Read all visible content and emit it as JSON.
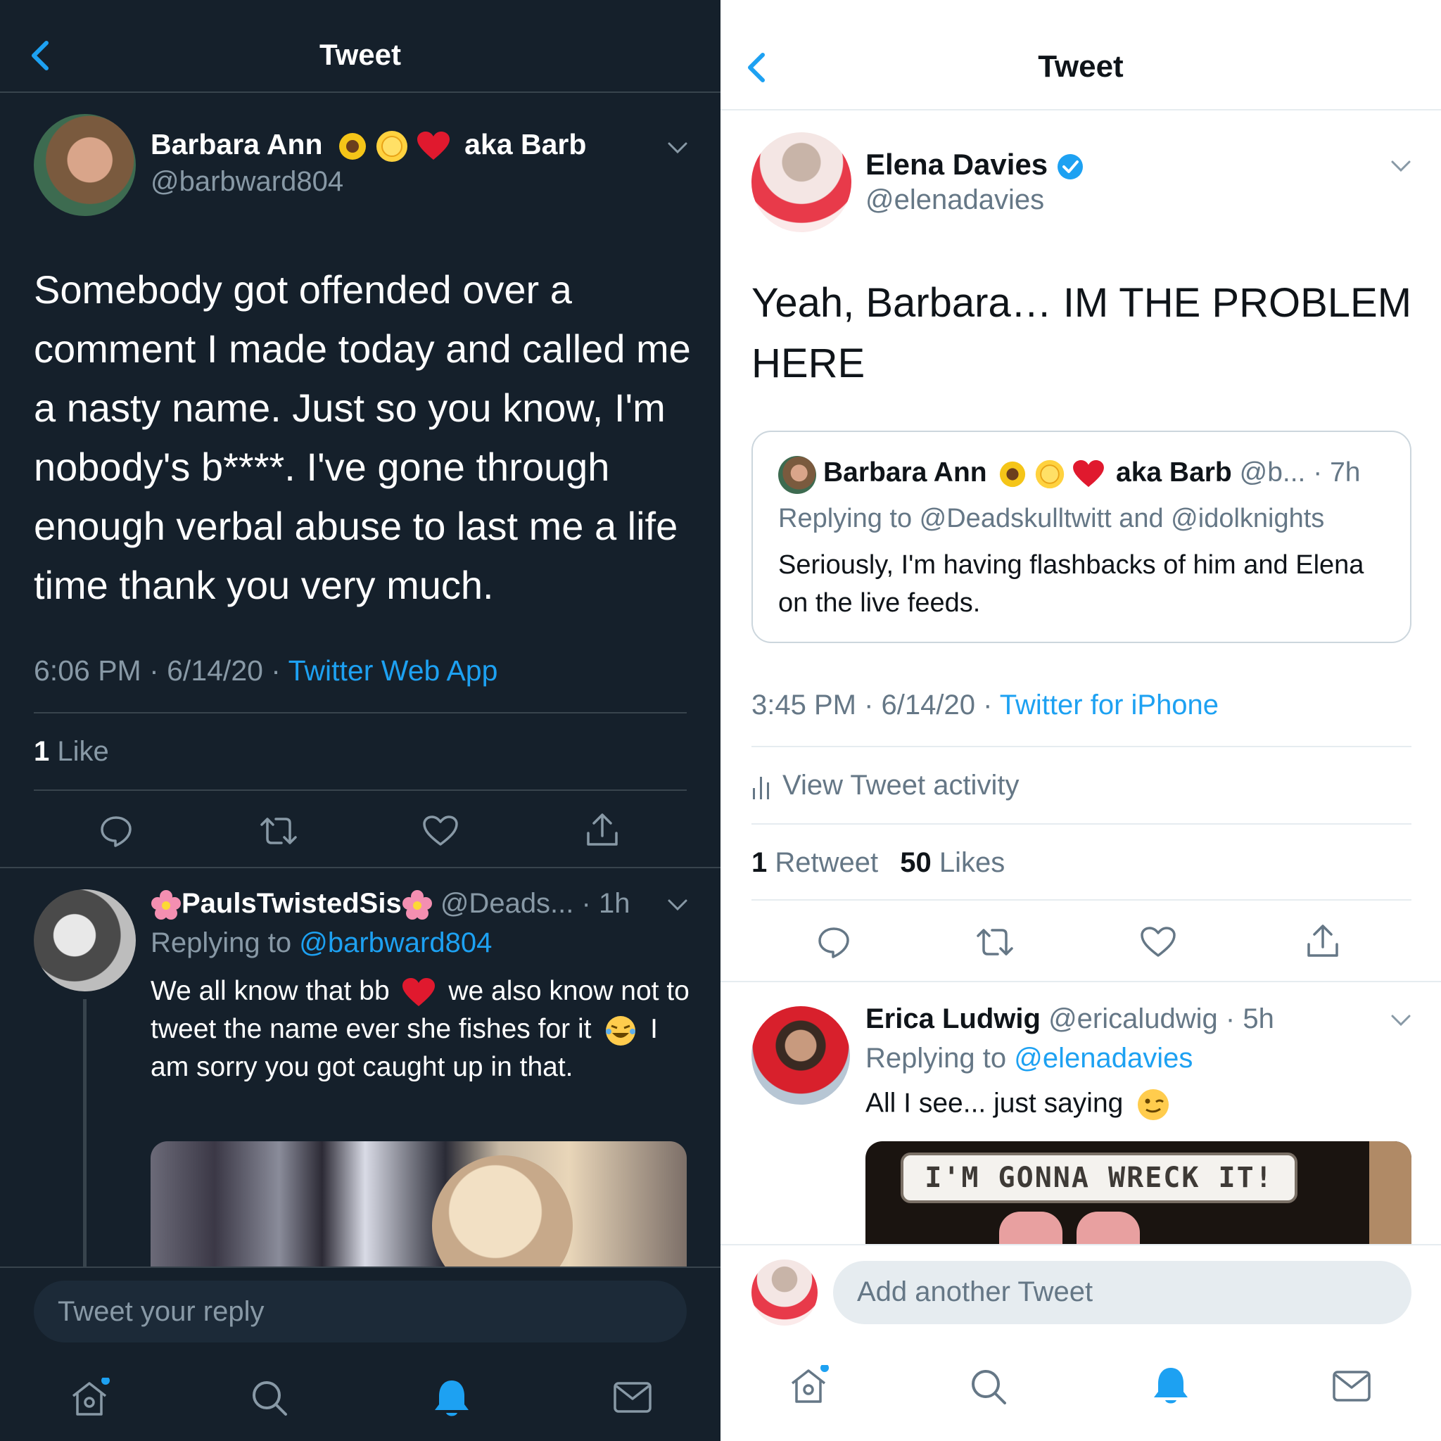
{
  "left": {
    "header": {
      "title": "Tweet"
    },
    "tweet": {
      "author_name": "Barbara Ann",
      "author_suffix": "aka Barb",
      "author_handle": "@barbward804",
      "body": "Somebody got offended over a comment I made today and called me a nasty name. Just so you know, I'm nobody's b****. I've gone through enough verbal abuse to last me a life time thank you very much.",
      "time": "6:06 PM · 6/14/20 ·",
      "source": "Twitter Web App",
      "likes_count": "1",
      "likes_label": "Like"
    },
    "reply": {
      "author_name": "PaulsTwistedSis",
      "author_handle": "@Deads...",
      "age": "· 1h",
      "replying_prefix": "Replying to",
      "replying_to": "@barbward804",
      "text_1": "We all know that bb",
      "text_2": "we also know not to tweet the name ever she fishes for it",
      "text_3": "I am sorry you got caught up in that."
    },
    "composer": {
      "placeholder": "Tweet your reply"
    }
  },
  "right": {
    "header": {
      "title": "Tweet"
    },
    "tweet": {
      "author_name": "Elena Davies",
      "author_handle": "@elenadavies",
      "body": "Yeah, Barbara… IM THE PROBLEM HERE",
      "time": "3:45 PM · 6/14/20 ·",
      "source": "Twitter for iPhone",
      "activity_label": "View Tweet activity",
      "retweets_count": "1",
      "retweets_label": "Retweet",
      "likes_count": "50",
      "likes_label": "Likes"
    },
    "quote": {
      "author_name": "Barbara Ann",
      "author_suffix": "aka Barb",
      "author_handle": "@b...",
      "age": "· 7h",
      "replying": "Replying to @Deadskulltwitt and @idolknights",
      "text": "Seriously, I'm having flashbacks of him and Elena on the live feeds."
    },
    "reply": {
      "author_name": "Erica Ludwig",
      "author_handle": "@ericaludwig",
      "age": "· 5h",
      "replying_prefix": "Replying to",
      "replying_to": "@elenadavies",
      "text": "All I see... just saying",
      "gif_caption": "I'M GONNA WRECK IT!"
    },
    "composer": {
      "placeholder": "Add another Tweet"
    }
  },
  "colors": {
    "dark_bg": "#15202b",
    "accent": "#1da1f2",
    "verified": "#1da1f2"
  },
  "icons": [
    "back-chevron-icon",
    "chevron-down-icon",
    "reply-icon",
    "retweet-icon",
    "like-icon",
    "share-icon",
    "home-icon",
    "search-icon",
    "notifications-icon",
    "messages-icon",
    "verified-badge-icon",
    "bar-chart-icon"
  ]
}
